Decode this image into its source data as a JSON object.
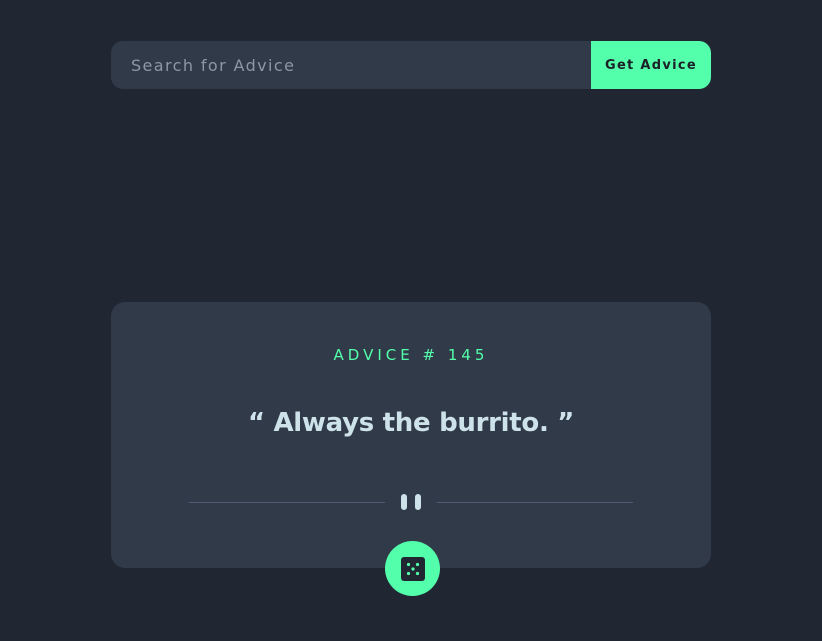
{
  "search": {
    "placeholder": "Search for Advice",
    "value": "",
    "button_label": "Get Advice"
  },
  "card": {
    "advice_id_label": "ADVICE # 145",
    "quote": "“ Always the burrito. ”",
    "divider_icon": "pause-icon",
    "dice_icon": "dice-icon"
  },
  "colors": {
    "background": "#202632",
    "card": "#313a49",
    "accent": "#53ffaa",
    "text_light": "#cee3e9",
    "placeholder": "#8c97a6",
    "divider": "#4f5d74"
  }
}
